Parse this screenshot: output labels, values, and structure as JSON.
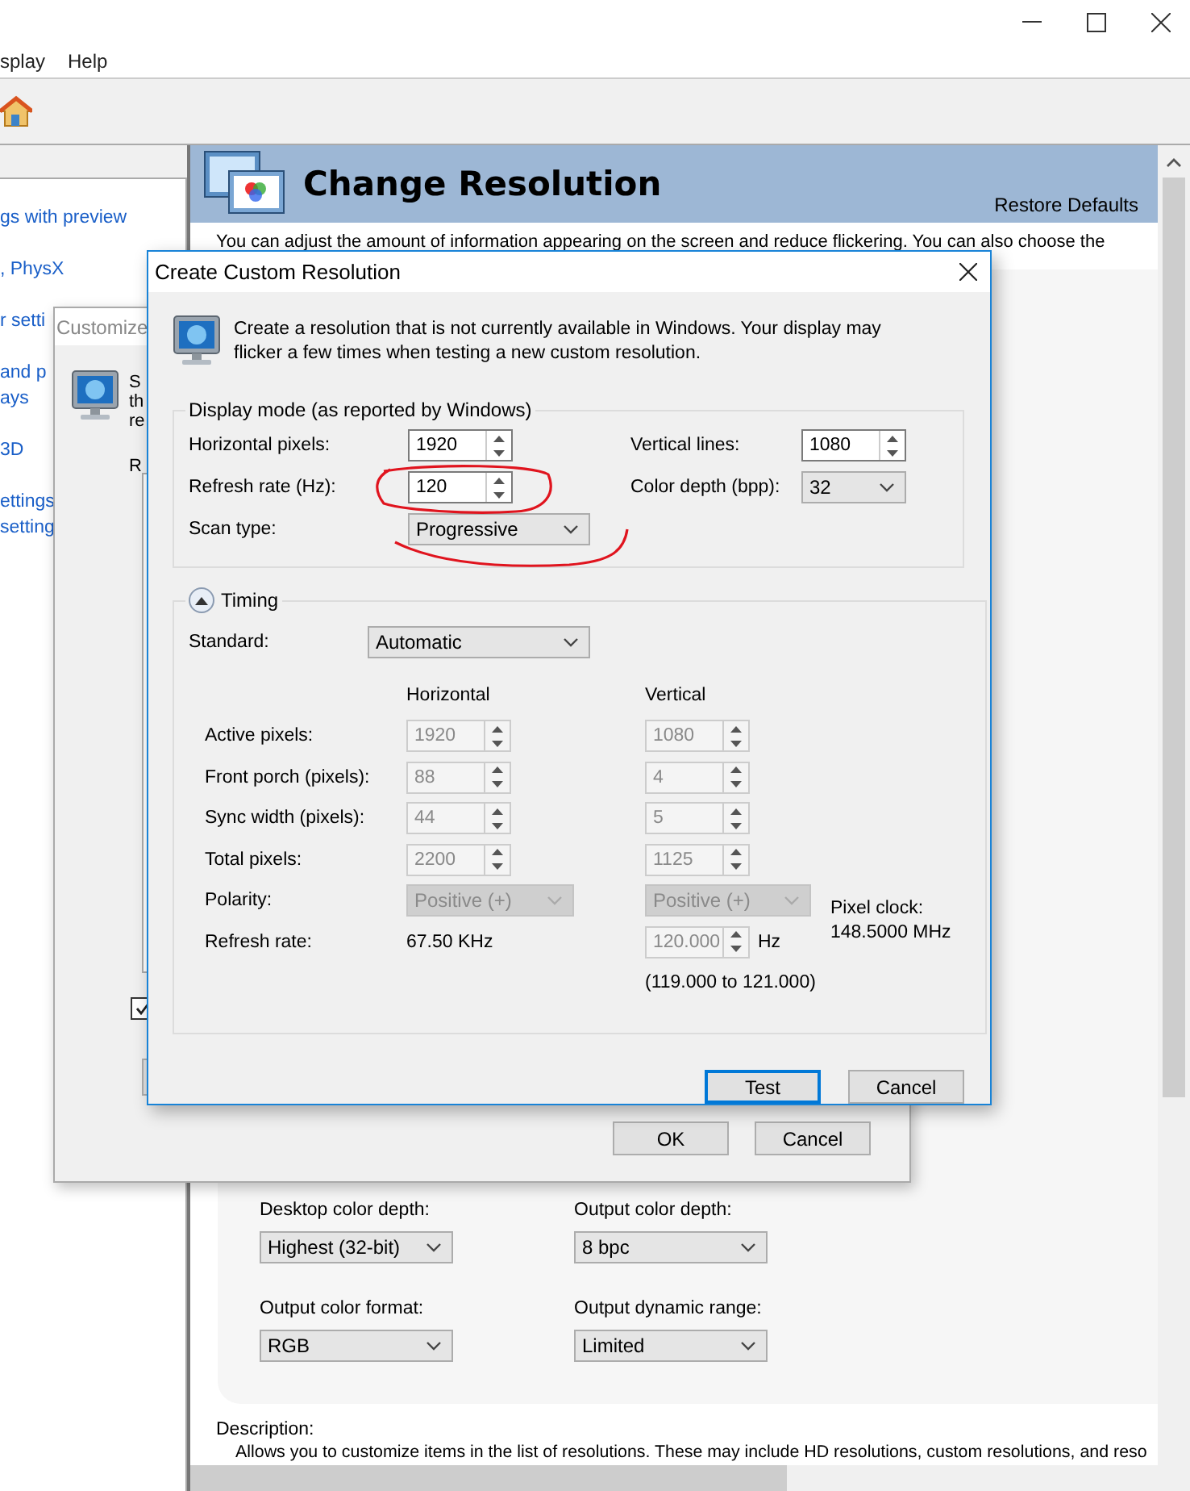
{
  "main_window": {
    "menu": [
      "splay",
      "Help"
    ],
    "sidebar_sections": [
      {
        "items": [
          "gs with preview"
        ]
      },
      {
        "items": [
          ", PhysX"
        ]
      },
      {
        "items": [
          "r setti"
        ]
      },
      {
        "items": [
          "and p",
          "ays"
        ]
      },
      {
        "items": [
          "3D"
        ]
      },
      {
        "items": [
          "ettings",
          "setting"
        ]
      }
    ],
    "header": {
      "title": "Change Resolution",
      "restore_link": "Restore Defaults"
    },
    "intro": "You can adjust the amount of information appearing on the screen and reduce flickering. You can also choose the",
    "settings": [
      {
        "label": "Desktop color depth:",
        "value": "Highest (32-bit)"
      },
      {
        "label": "Output color depth:",
        "value": "8 bpc"
      },
      {
        "label": "Output color format:",
        "value": "RGB"
      },
      {
        "label": "Output dynamic range:",
        "value": "Limited"
      }
    ],
    "description": {
      "label": "Description:",
      "text": "Allows you to customize items in the list of resolutions. These may include HD resolutions, custom resolutions, and reso"
    }
  },
  "customize_dialog": {
    "title": "Customize",
    "text_fragments": [
      "S",
      "th",
      "re"
    ],
    "list_label": "R",
    "checkbox": {
      "checked": true
    },
    "buttons": [
      "OK",
      "Cancel"
    ]
  },
  "custom_resolution_dialog": {
    "title": "Create Custom Resolution",
    "intro": "Create a resolution that is not currently available in Windows. Your display may flicker a few times when testing a new custom resolution.",
    "display_mode": {
      "legend": "Display mode (as reported by Windows)",
      "horizontal_pixels": {
        "label": "Horizontal pixels:",
        "value": "1920"
      },
      "vertical_lines": {
        "label": "Vertical lines:",
        "value": "1080"
      },
      "refresh_rate": {
        "label": "Refresh rate (Hz):",
        "value": "120"
      },
      "color_depth": {
        "label": "Color depth (bpp):",
        "value": "32"
      },
      "scan_type": {
        "label": "Scan type:",
        "value": "Progressive"
      }
    },
    "timing": {
      "label": "Timing",
      "expanded": true,
      "disabled": true,
      "standard": {
        "label": "Standard:",
        "value": "Automatic"
      },
      "columns": [
        "Horizontal",
        "Vertical"
      ],
      "rows": [
        {
          "label": "Active pixels:",
          "horizontal": "1920",
          "vertical": "1080"
        },
        {
          "label": "Front porch (pixels):",
          "horizontal": "88",
          "vertical": "4"
        },
        {
          "label": "Sync width (pixels):",
          "horizontal": "44",
          "vertical": "5"
        },
        {
          "label": "Total pixels:",
          "horizontal": "2200",
          "vertical": "1125"
        }
      ],
      "polarity": {
        "label": "Polarity:",
        "horizontal": "Positive (+)",
        "vertical": "Positive (+)",
        "disabled": true
      },
      "refresh": {
        "label": "Refresh rate:",
        "horizontal": "67.50 KHz",
        "vertical": "120.000",
        "unit": "Hz",
        "range": "(119.000 to 121.000)"
      },
      "pixel_clock": {
        "label": "Pixel clock:",
        "value": "148.5000 MHz"
      }
    },
    "buttons": [
      {
        "label": "Test",
        "default": true
      },
      {
        "label": "Cancel",
        "default": false
      }
    ]
  }
}
